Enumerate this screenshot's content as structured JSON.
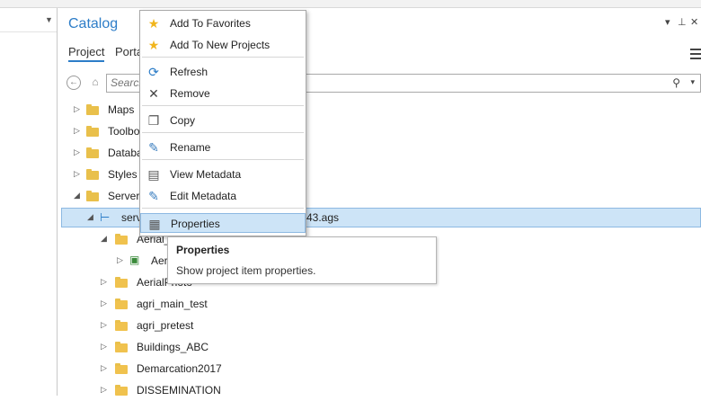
{
  "catalog": {
    "title": "Catalog",
    "tabs": [
      {
        "label": "Project"
      },
      {
        "label": "Porta"
      }
    ],
    "search_placeholder": "Search"
  },
  "tree": {
    "items": [
      {
        "label": "Maps"
      },
      {
        "label": "Toolbo"
      },
      {
        "label": "Databa"
      },
      {
        "label": "Styles"
      },
      {
        "label": "Servers"
      },
      {
        "label": "serv",
        "suffix": "43.ags"
      },
      {
        "label": "Aerial_"
      },
      {
        "label": "Aer"
      },
      {
        "label": "AerialPhoto"
      },
      {
        "label": "agri_main_test"
      },
      {
        "label": "agri_pretest"
      },
      {
        "label": "Buildings_ABC"
      },
      {
        "label": "Demarcation2017"
      },
      {
        "label": "DISSEMINATION"
      }
    ]
  },
  "context_menu": {
    "items": [
      {
        "label": "Add To Favorites",
        "icon": "star-icon"
      },
      {
        "label": "Add To New Projects",
        "icon": "star-icon"
      },
      {
        "label": "Refresh",
        "icon": "refresh-icon"
      },
      {
        "label": "Remove",
        "icon": "remove-icon"
      },
      {
        "label": "Copy",
        "icon": "copy-icon"
      },
      {
        "label": "Rename",
        "icon": "rename-icon"
      },
      {
        "label": "View Metadata",
        "icon": "view-metadata-icon"
      },
      {
        "label": "Edit Metadata",
        "icon": "edit-metadata-icon"
      },
      {
        "label": "Properties",
        "icon": "properties-icon"
      }
    ]
  },
  "tooltip": {
    "title": "Properties",
    "description": "Show project item properties."
  },
  "colors": {
    "accent": "#2d7dc8",
    "selection": "#cde4f7",
    "folder": "#e9c04b",
    "star": "#f1b51c"
  }
}
